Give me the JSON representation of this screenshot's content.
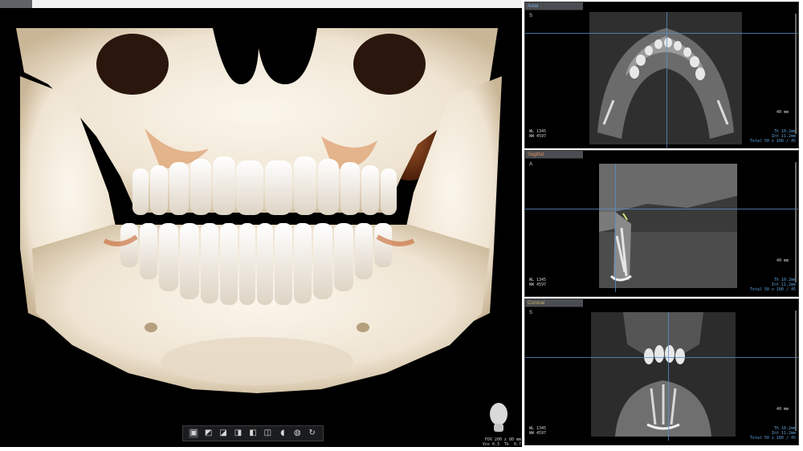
{
  "viewport3d": {
    "toolbar_buttons": [
      "▣",
      "◩",
      "◪",
      "◨",
      "◧",
      "◫",
      "◖",
      "◍",
      "↻"
    ],
    "fov_text": "FOV 200 x 80 mm\nVox 0.3  Tk  0.7"
  },
  "panels": {
    "axial": {
      "tab_label": "Axial",
      "orient": "S",
      "scale_label": "40 mm",
      "info_left": "WL 1345\nWW 4597",
      "info_right": "Th 10.2mm\nInt 11.2mm\nTotal 50 x 100 / 45"
    },
    "sagittal": {
      "tab_label": "Sagittal",
      "orient": "A",
      "scale_label": "40 mm",
      "info_left": "WL 1345\nWW 4597",
      "info_right": "Th 10.2mm\nInt 11.2mm\nTotal 50 x 100 / 45"
    },
    "coronal": {
      "tab_label": "Coronal",
      "orient": "S",
      "scale_label": "40 mm",
      "info_left": "WL 1345\nWW 4597",
      "info_right": "Th 10.2mm\nInt 11.2mm\nTotal 50 x 100 / 45"
    }
  },
  "colors": {
    "bone": "#f3ebdd",
    "bone_shadow": "#c9b9a0",
    "tissue_orange": "#c7622b",
    "crosshair_blue": "#5b8fc9",
    "panel_bg": "#000000"
  }
}
